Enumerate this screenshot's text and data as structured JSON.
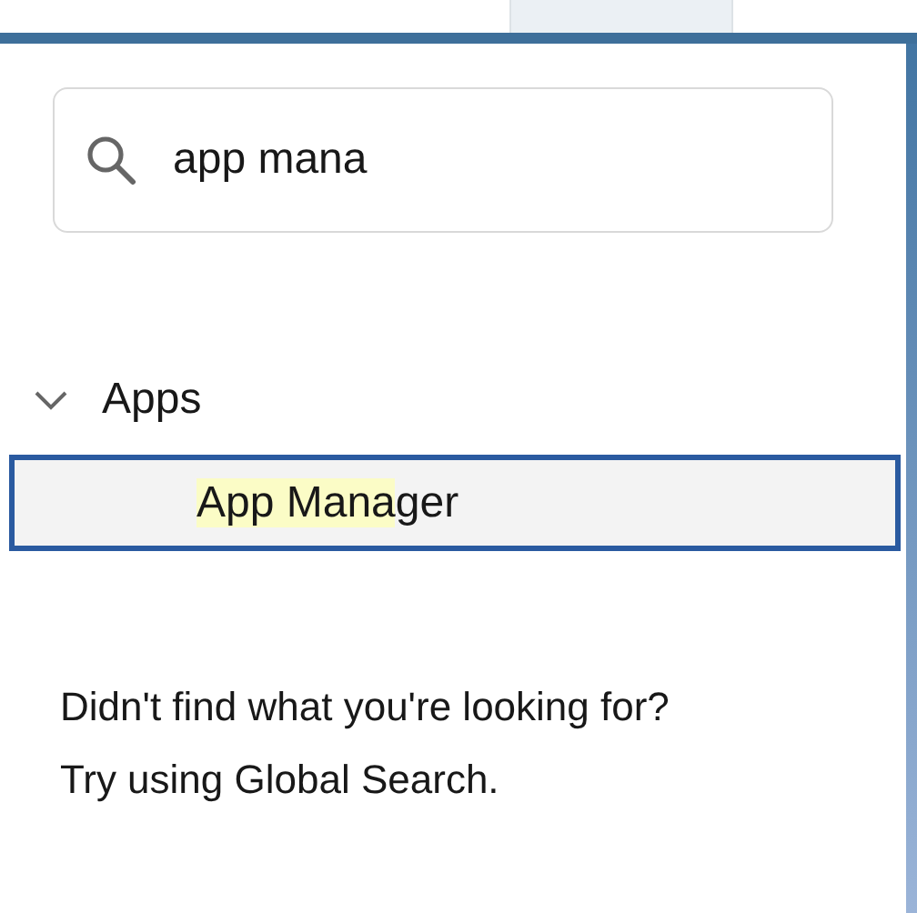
{
  "search": {
    "value": "app mana"
  },
  "groups": [
    {
      "label": "Apps",
      "expanded": true,
      "items": [
        {
          "highlight": "App Mana",
          "rest": "ger",
          "selected": true
        }
      ]
    }
  ],
  "message": {
    "lines": [
      "Didn't find what you're looking for?",
      "Try using Global Search."
    ]
  }
}
